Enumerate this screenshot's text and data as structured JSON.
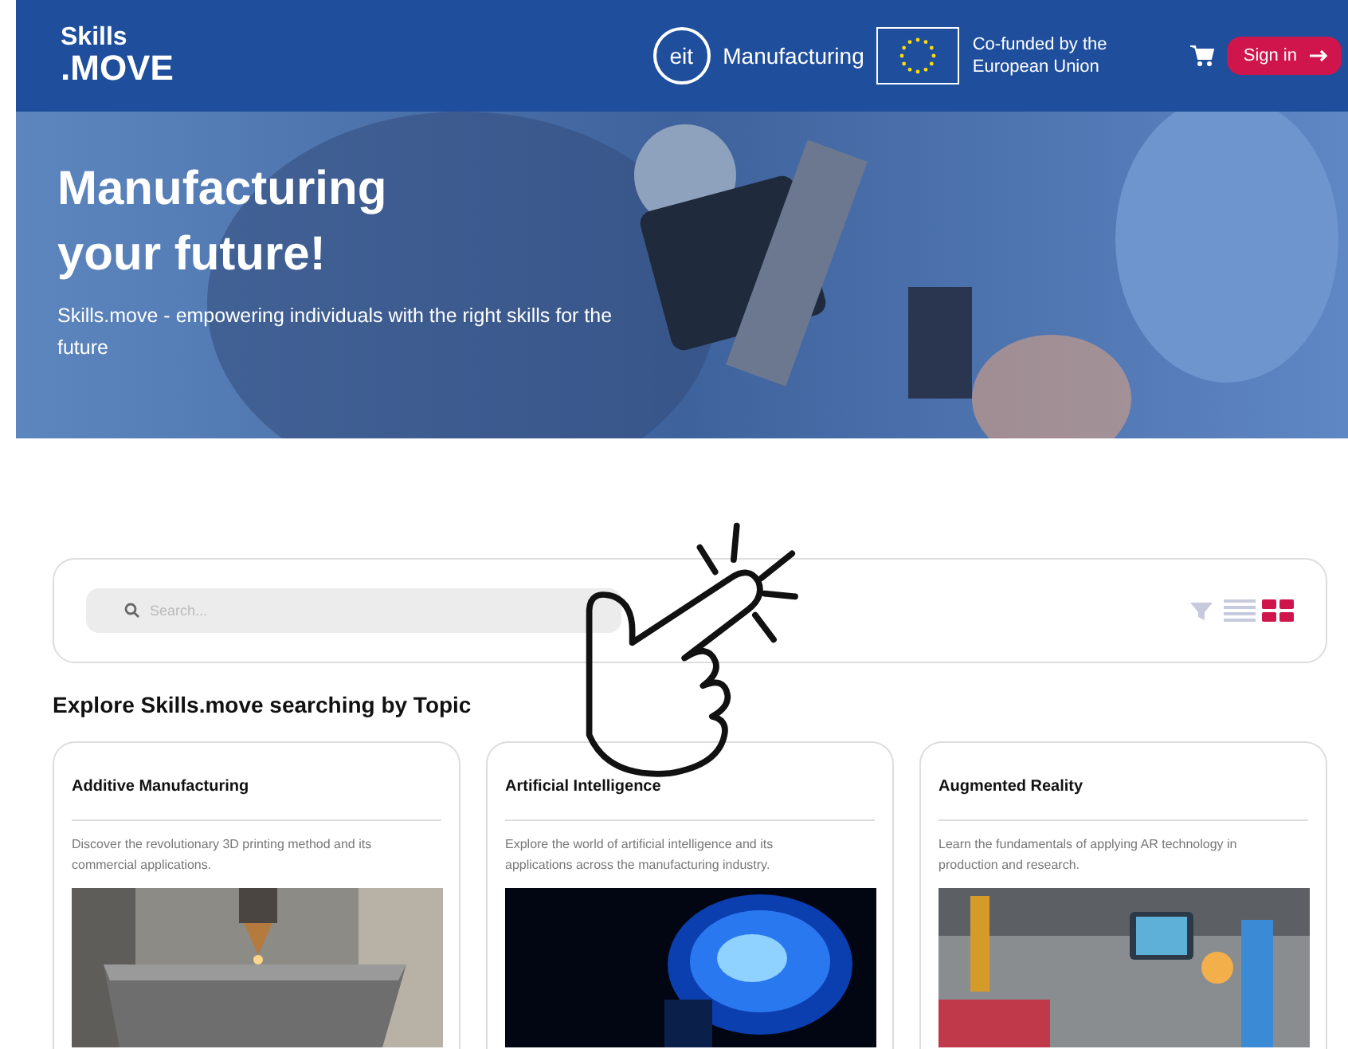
{
  "header": {
    "logo_top": "Skills",
    "logo_bottom": ".MOVE",
    "partner": "Manufacturing",
    "partner_mark": "eit",
    "eu_text": "Co-funded by the European Union",
    "signin": "Sign in"
  },
  "hero": {
    "title": "Manufacturing your future!",
    "subtitle": "Skills.move - empowering individuals with the right skills for the future",
    "kind": "picture"
  },
  "search": {
    "placeholder": "Search...",
    "views": [
      {
        "kind": "list",
        "selected": false
      },
      {
        "kind": "grid",
        "selected": true
      }
    ]
  },
  "section_title": "Explore Skills.move searching by Topic",
  "topics": [
    {
      "title": "Additive Manufacturing",
      "description": "Discover the revolutionary 3D printing method and its commercial applications.",
      "kind": "printer"
    },
    {
      "title": "Artificial Intelligence",
      "description": "Explore the world of artificial intelligence and its applications across the manufacturing industry.",
      "kind": "brain"
    },
    {
      "title": "Augmented Reality",
      "description": "Learn the fundamentals of applying AR technology in production and research.",
      "kind": "factory"
    }
  ]
}
